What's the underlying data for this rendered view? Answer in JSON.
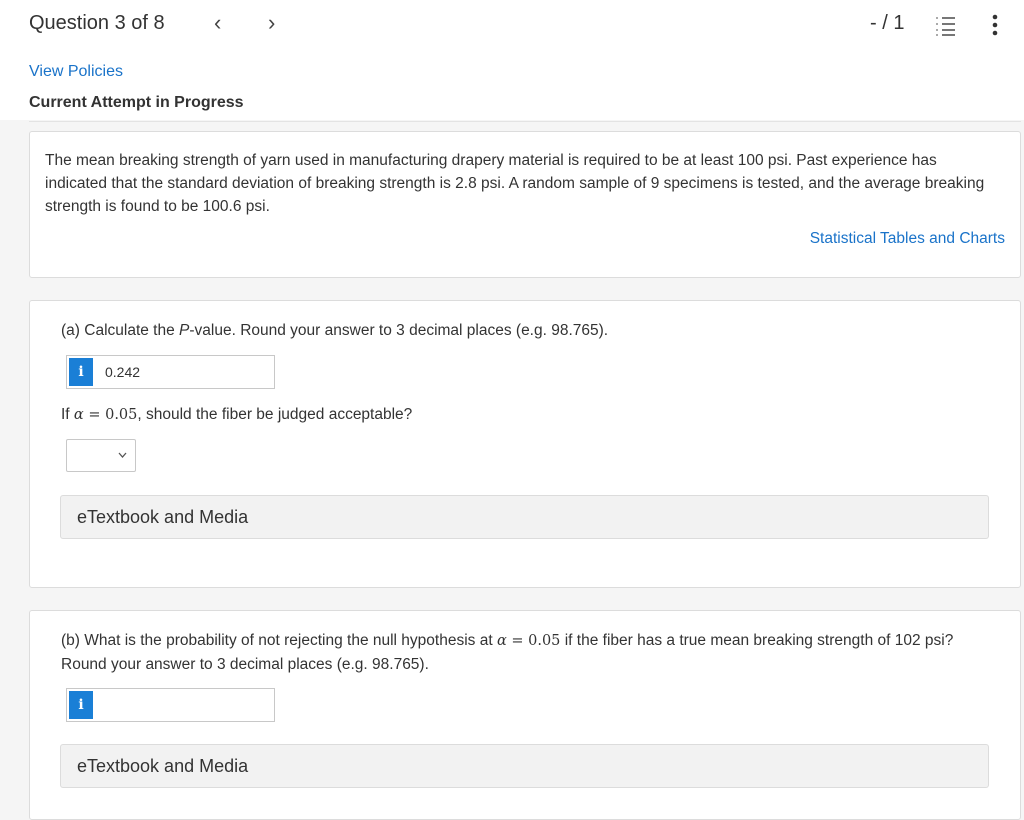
{
  "header": {
    "question_label": "Question 3 of 8",
    "prev_icon": "‹",
    "next_icon": "›",
    "score": "- / 1",
    "list_icon": "list-icon",
    "menu_icon": "kebab-menu-icon"
  },
  "links": {
    "view_policies": "View Policies"
  },
  "attempt_label": "Current Attempt in Progress",
  "problem": {
    "text": "The mean breaking strength of yarn used in manufacturing drapery material is required to be at least 100 psi. Past experience has indicated that the standard deviation of breaking strength is 2.8 psi. A random sample of 9 specimens is tested, and the average breaking strength is found to be 100.6 psi.",
    "tables_link": "Statistical Tables and Charts"
  },
  "part_a": {
    "prompt_pre": "(a) Calculate the ",
    "prompt_em": "P",
    "prompt_post": "-value. Round your answer to 3 decimal places (e.g. 98.765).",
    "info_label": "i",
    "answer_value": "0.242",
    "question_pre": "If ",
    "alpha": "α",
    "equals": " = ",
    "alpha_value": "0.05",
    "question_post": ", should the fiber be judged acceptable?",
    "select_value": "",
    "media_label": "eTextbook and Media"
  },
  "part_b": {
    "prompt_pre": "(b) What is the probability of not rejecting the null hypothesis at ",
    "alpha": "α",
    "equals": " = ",
    "alpha_value": "0.05",
    "prompt_post": " if the fiber has a true mean breaking strength of 102 psi? Round your answer to 3 decimal places (e.g. 98.765).",
    "info_label": "i",
    "answer_value": "",
    "media_label": "eTextbook and Media"
  },
  "colors": {
    "link": "#1a73c9",
    "info_badge": "#1a7fd6",
    "page_bg": "#f5f5f5",
    "card_bg": "#ffffff"
  }
}
